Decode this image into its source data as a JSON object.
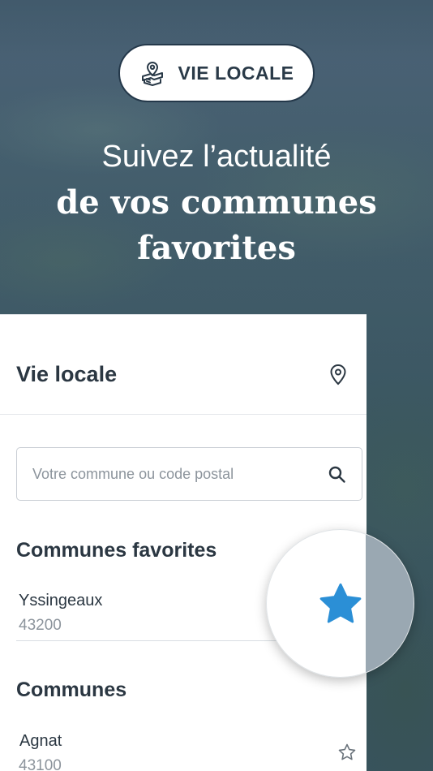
{
  "badge": {
    "label": "VIE LOCALE",
    "icon": "map-pin-newspaper-icon"
  },
  "hero": {
    "line1": "Suivez l’actualité",
    "line2": "de vos communes",
    "line3": "favorites"
  },
  "app": {
    "title": "Vie locale",
    "location_icon": "location-pin-icon",
    "search": {
      "placeholder": "Votre commune ou code postal",
      "value": "",
      "icon": "search-icon"
    },
    "favorites": {
      "title": "Communes favorites",
      "items": [
        {
          "name": "Yssingeaux",
          "code": "43200",
          "favorite": true
        }
      ]
    },
    "communes": {
      "title": "Communes",
      "items": [
        {
          "name": "Agnat",
          "code": "43100",
          "favorite": false
        }
      ]
    }
  },
  "colors": {
    "star_active": "#2b8fd6",
    "text_dark": "#2b3742",
    "text_muted": "#8c949c"
  }
}
